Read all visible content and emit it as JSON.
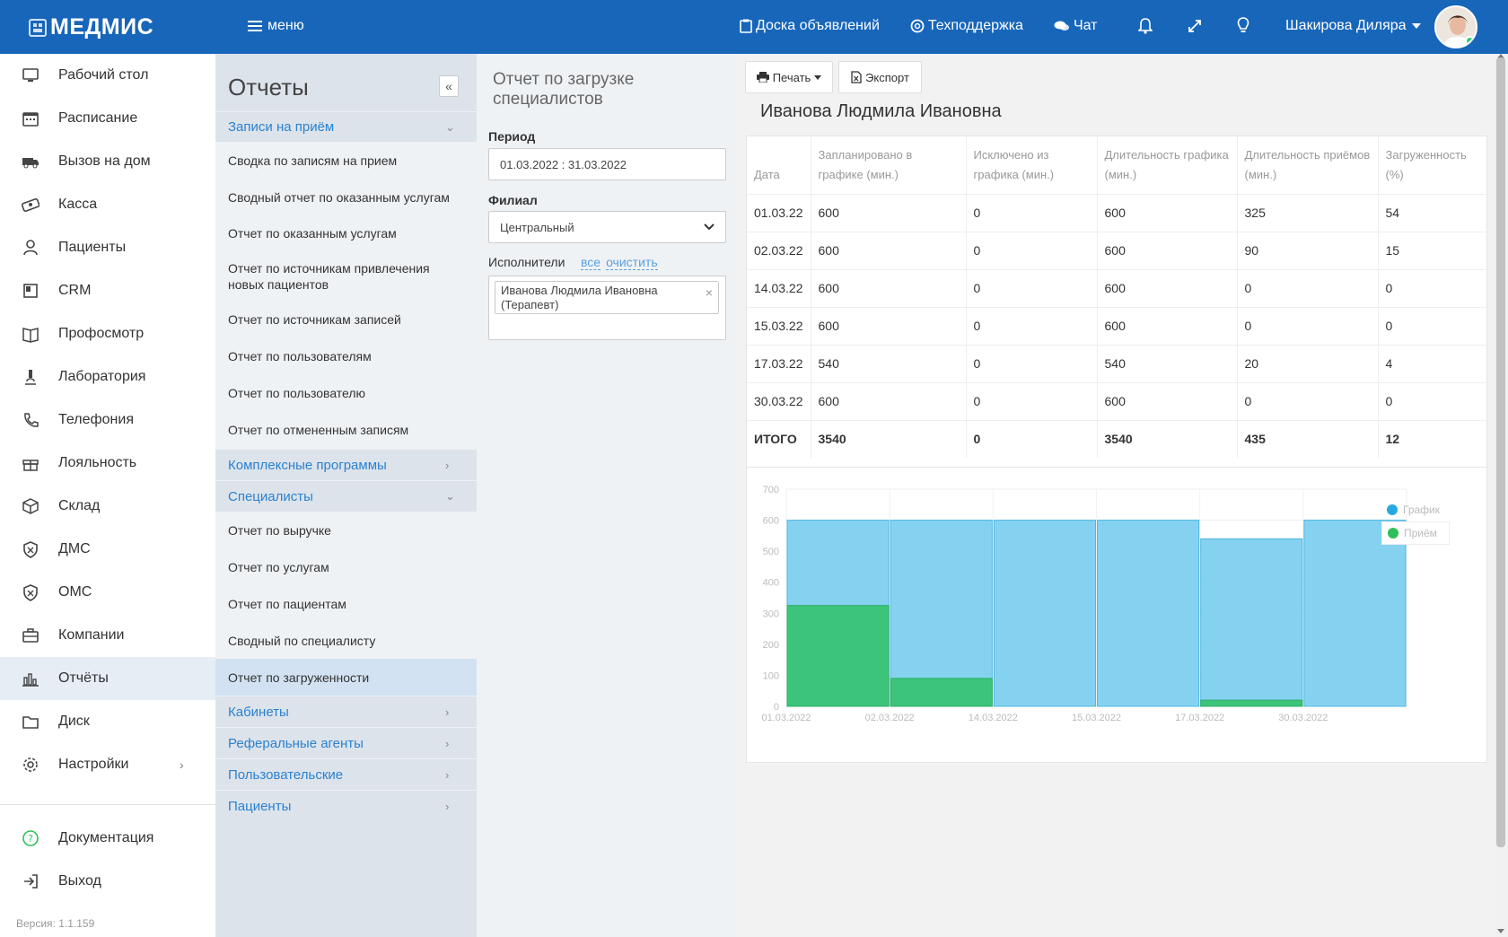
{
  "topbar": {
    "logo": "МЕДМИС",
    "menu_label": "меню",
    "links": [
      "Доска объявлений",
      "Техподдержка",
      "Чат"
    ],
    "user_name": "Шакирова Диляра"
  },
  "sidebar": {
    "items": [
      {
        "label": "Рабочий стол",
        "icon": "monitor-icon"
      },
      {
        "label": "Расписание",
        "icon": "calendar-icon"
      },
      {
        "label": "Вызов на дом",
        "icon": "ambulance-icon"
      },
      {
        "label": "Касса",
        "icon": "money-icon"
      },
      {
        "label": "Пациенты",
        "icon": "user-icon"
      },
      {
        "label": "CRM",
        "icon": "crm-icon"
      },
      {
        "label": "Профосмотр",
        "icon": "book-icon"
      },
      {
        "label": "Лаборатория",
        "icon": "microscope-icon"
      },
      {
        "label": "Телефония",
        "icon": "phone-icon"
      },
      {
        "label": "Лояльность",
        "icon": "gift-icon"
      },
      {
        "label": "Склад",
        "icon": "box-icon"
      },
      {
        "label": "ДМС",
        "icon": "shield-icon"
      },
      {
        "label": "ОМС",
        "icon": "shield-icon"
      },
      {
        "label": "Компании",
        "icon": "briefcase-icon"
      },
      {
        "label": "Отчёты",
        "icon": "chart-icon"
      },
      {
        "label": "Диск",
        "icon": "folder-icon"
      },
      {
        "label": "Настройки",
        "icon": "gear-icon"
      }
    ],
    "bottom": [
      {
        "label": "Документация",
        "icon": "help-icon"
      },
      {
        "label": "Выход",
        "icon": "logout-icon"
      }
    ],
    "version": "Версия: 1.1.159"
  },
  "reports": {
    "title": "Отчеты",
    "collapse": "«",
    "sec1": "Записи на приём",
    "sec1_items": [
      "Сводка по записям на прием",
      "Сводный отчет по оказанным услугам",
      "Отчет по оказанным услугам",
      "Отчет по источникам привлечения новых пациентов",
      "Отчет по источникам записей",
      "Отчет по пользователям",
      "Отчет по пользователю",
      "Отчет по отмененным записям"
    ],
    "sec2": "Комплексные программы",
    "sec3": "Специалисты",
    "sec3_items": [
      "Отчет по выручке",
      "Отчет по услугам",
      "Отчет по пациентам",
      "Сводный по специалисту",
      "Отчет по загруженности"
    ],
    "sec4": "Кабинеты",
    "sec5": "Реферальные агенты",
    "sec6": "Пользовательские",
    "sec7": "Пациенты"
  },
  "filter": {
    "title": "Отчет по загрузке специалистов",
    "period_label": "Период",
    "period_value": "01.03.2022 : 31.03.2022",
    "branch_label": "Филиал",
    "branch_value": "Центральный",
    "performers_label": "Исполнители",
    "link_all": "все",
    "link_clear": "очистить",
    "tag": "Иванова Людмила Ивановна (Терапевт)",
    "tag_close": "×"
  },
  "main": {
    "print_label": "Печать",
    "export_label": "Экспорт",
    "person": "Иванова Людмила Ивановна",
    "columns": [
      "Дата",
      "Запланировано в графике (мин.)",
      "Исключено из графика (мин.)",
      "Длительность графика (мин.)",
      "Длительность приёмов (мин.)",
      "Загруженность (%)"
    ],
    "rows": [
      [
        "01.03.22",
        "600",
        "0",
        "600",
        "325",
        "54"
      ],
      [
        "02.03.22",
        "600",
        "0",
        "600",
        "90",
        "15"
      ],
      [
        "14.03.22",
        "600",
        "0",
        "600",
        "0",
        "0"
      ],
      [
        "15.03.22",
        "600",
        "0",
        "600",
        "0",
        "0"
      ],
      [
        "17.03.22",
        "540",
        "0",
        "540",
        "20",
        "4"
      ],
      [
        "30.03.22",
        "600",
        "0",
        "600",
        "0",
        "0"
      ]
    ],
    "total": [
      "ИТОГО",
      "3540",
      "0",
      "3540",
      "435",
      "12"
    ]
  },
  "chart_data": {
    "type": "bar",
    "categories": [
      "01.03.2022",
      "02.03.2022",
      "14.03.2022",
      "15.03.2022",
      "17.03.2022",
      "30.03.2022"
    ],
    "series": [
      {
        "name": "График",
        "values": [
          600,
          600,
          600,
          600,
          540,
          600
        ],
        "color": "#7fcfee"
      },
      {
        "name": "Приём",
        "values": [
          325,
          90,
          0,
          0,
          20,
          0
        ],
        "color": "#3cc47a"
      }
    ],
    "overlay": true,
    "ylim": [
      0,
      700
    ],
    "yticks": [
      0,
      100,
      200,
      300,
      400,
      500,
      600,
      700
    ],
    "grid": true,
    "legend": "top-right"
  },
  "colors": {
    "accent": "#1766ba",
    "link": "#2a82d1"
  }
}
